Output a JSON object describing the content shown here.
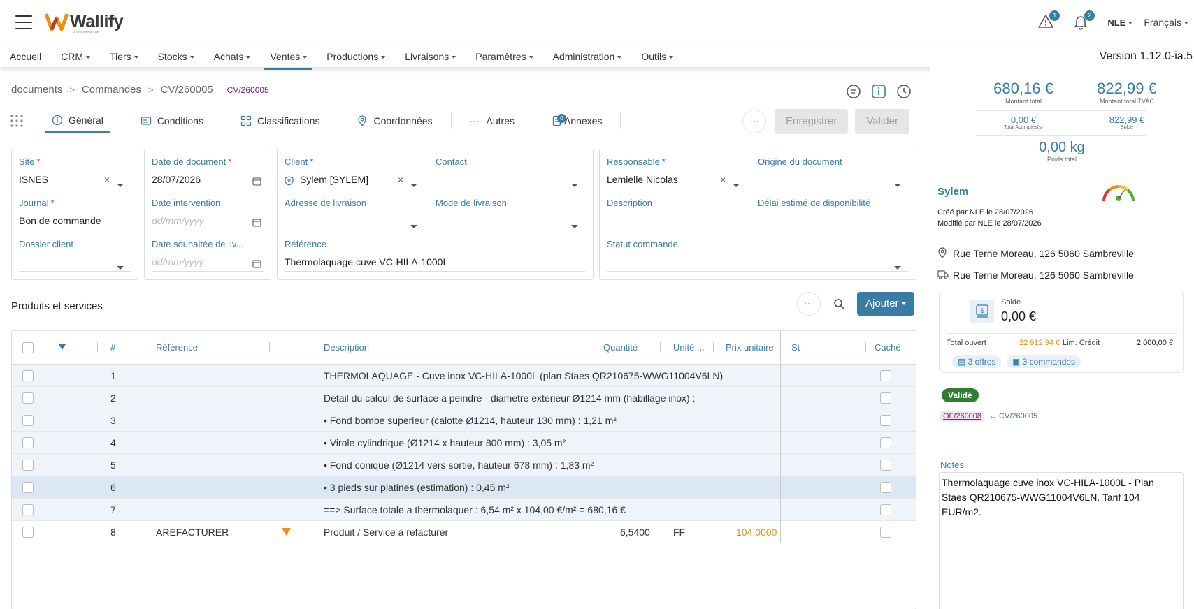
{
  "header": {
    "logo": "Wallify",
    "logo_sub": "VOTRE ERP BELGE",
    "warnings_count": "1",
    "notifications_count": "2",
    "user": "NLE",
    "language": "Français"
  },
  "nav": {
    "items": [
      "Accueil",
      "CRM",
      "Tiers",
      "Stocks",
      "Achats",
      "Ventes",
      "Productions",
      "Livraisons",
      "Paramètres",
      "Administration",
      "Outils"
    ],
    "version": "Version 1.12.0-ia.5"
  },
  "breadcrumb": {
    "items": [
      "documents",
      "Commandes",
      "CV/260005"
    ],
    "code": "CV/260005"
  },
  "tabs": {
    "general": "Général",
    "conditions": "Conditions",
    "classifications": "Classifications",
    "coordonnees": "Coordonnées",
    "autres": "Autres",
    "annexes": "Annexes",
    "annexes_count": "0",
    "save": "Enregistrer",
    "validate": "Valider"
  },
  "form": {
    "site_label": "Site",
    "site_value": "ISNES",
    "journal_label": "Journal",
    "journal_value": "Bon de commande",
    "dossier_label": "Dossier client",
    "date_doc_label": "Date de document",
    "date_doc_value": "28/07/2026",
    "date_intervention_label": "Date intervention",
    "date_placeholder": "dd/mm/yyyy",
    "date_souhaitee_label": "Date souhaitée de liv...",
    "client_label": "Client",
    "client_value": "Sylem [SYLEM]",
    "contact_label": "Contact",
    "adresse_label": "Adresse de livraison",
    "mode_label": "Mode de livraison",
    "reference_label": "Référence",
    "reference_value": "Thermolaquage cuve VC-HILA-1000L",
    "responsable_label": "Responsable",
    "responsable_value": "Lemielle Nicolas",
    "origine_label": "Origine du document",
    "description_label": "Description",
    "delai_label": "Délai estimé de disponibilité",
    "statut_label": "Statut commande"
  },
  "products": {
    "title": "Produits et services",
    "add_button": "Ajouter",
    "headers": {
      "num": "#",
      "reference": "Référence",
      "description": "Description",
      "quantite": "Quantité",
      "unite": "Unité ...",
      "prix": "Prix unitaire",
      "st": "St",
      "cache": "Caché"
    },
    "rows": [
      {
        "num": "1",
        "ref": "",
        "desc": "THERMOLAQUAGE - Cuve inox VC-HILA-1000L (plan Staes QR210675-WWG11004V6LN)",
        "qty": "",
        "unit": "",
        "price": ""
      },
      {
        "num": "2",
        "ref": "",
        "desc": "Detail du calcul de surface a peindre - diametre exterieur Ø1214 mm (habillage inox) :",
        "qty": "",
        "unit": "",
        "price": ""
      },
      {
        "num": "3",
        "ref": "",
        "desc": "• Fond bombe superieur (calotte Ø1214, hauteur 130 mm) : 1,21 m²",
        "qty": "",
        "unit": "",
        "price": ""
      },
      {
        "num": "4",
        "ref": "",
        "desc": "• Virole cylindrique (Ø1214 x hauteur 800 mm) : 3,05 m²",
        "qty": "",
        "unit": "",
        "price": ""
      },
      {
        "num": "5",
        "ref": "",
        "desc": "• Fond conique (Ø1214 vers sortie, hauteur 678 mm) : 1,83 m²",
        "qty": "",
        "unit": "",
        "price": ""
      },
      {
        "num": "6",
        "ref": "",
        "desc": "• 3 pieds sur platines (estimation) : 0,45 m²",
        "qty": "",
        "unit": "",
        "price": ""
      },
      {
        "num": "7",
        "ref": "",
        "desc": "==> Surface totale a thermolaquer : 6,54 m² x 104,00 €/m² = 680,16 €",
        "qty": "",
        "unit": "",
        "price": ""
      },
      {
        "num": "8",
        "ref": "AREFACTURER",
        "desc": "Produit / Service à refacturer",
        "qty": "6,5400",
        "unit": "FF",
        "price": "104,0000"
      }
    ]
  },
  "summary": {
    "montant_total": "680,16 €",
    "montant_total_label": "Montant total",
    "montant_tvac": "822,99 €",
    "montant_tvac_label": "Montant total TVAC",
    "acomptes": "0,00 €",
    "acomptes_label": "Total Acomptes(s)",
    "solde": "822,99 €",
    "solde_label": "Solde",
    "poids": "0,00 kg",
    "poids_label": "Poids total"
  },
  "client_card": {
    "name": "Sylem",
    "created": "Créé par NLE le 28/07/2026",
    "modified": "Modifié par NLE le 28/07/2026",
    "address1": "Rue Terne Moreau, 126 5060 Sambreville",
    "address2": "Rue Terne Moreau, 126 5060 Sambreville",
    "solde_label": "Solde",
    "solde_value": "0,00 €",
    "total_ouvert_label": "Total ouvert",
    "total_ouvert_value": "22 912,94 €",
    "lim_credit_label": "Lim. Crédit",
    "lim_credit_value": "2 000,00 €",
    "offres": "3 offres",
    "commandes": "3 commandes",
    "status": "Validé",
    "link_of": "OF/260008",
    "link_cv": "← CV/260005",
    "notes_label": "Notes",
    "notes": "Thermolaquage cuve inox VC-HILA-1000L - Plan Staes QR210675-WWG11004V6LN. Tarif 104 EUR/m2."
  },
  "colors": {
    "accent": "#3a7ca5",
    "orange": "#e8901a",
    "purple": "#8a1a6c",
    "green": "#2e7d32"
  }
}
